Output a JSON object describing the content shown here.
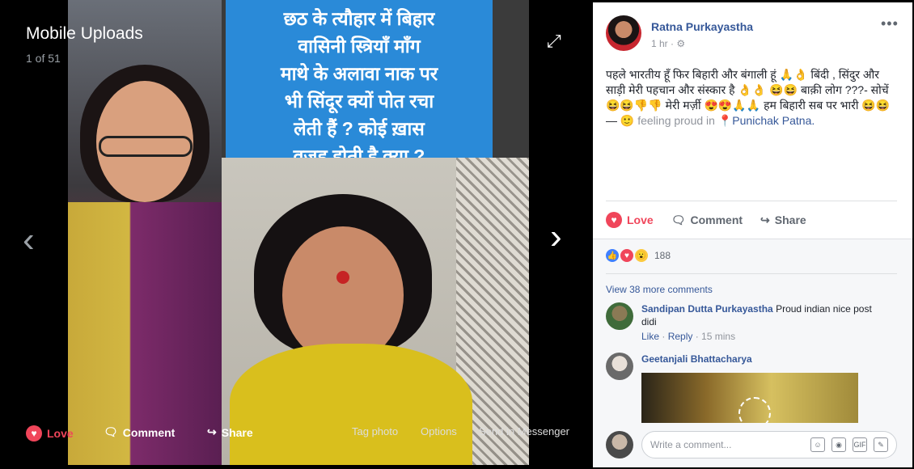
{
  "viewer": {
    "title": "Mobile Uploads",
    "count": "1 of 51",
    "sign_lines": [
      "छठ के त्यौहार में बिहार",
      "वासिनी स्त्रियाँ माँग",
      "माथे के अलावा नाक पर",
      "भी सिंदूर क्यों पोत रचा",
      "लेती हैं ? कोई ख़ास",
      "वजह होती है क्या ?"
    ],
    "actions": {
      "love": "Love",
      "comment": "Comment",
      "share": "Share",
      "tag": "Tag photo",
      "options": "Options",
      "messenger": "Send in Messenger"
    }
  },
  "post": {
    "author": "Ratna Purkayastha",
    "time": "1 hr",
    "text_main": "पहले भारतीय हूँ फिर बिहारी और बंगाली हूं 🙏👌 बिंदी , सिंदुर और साड़ी मेरी पहचान और संस्कार है 👌👌 😆😆 बाक़ी लोग ???- सोचें 😆😆👎👎 मेरी मर्ज़ी 😍😍🙏🙏 हम बिहारी सब पर भारी 😆😆 — ",
    "feeling": "feeling proud in",
    "location": "Punichak Patna",
    "location_suffix": ".",
    "actions": {
      "love": "Love",
      "comment": "Comment",
      "share": "Share"
    },
    "reaction_count": "188",
    "view_more": "View 38 more comments"
  },
  "comments": [
    {
      "name": "Sandipan Dutta Purkayastha",
      "text": "Proud indian nice post didi",
      "like": "Like",
      "reply": "Reply",
      "time": "15 mins"
    },
    {
      "name": "Geetanjali Bhattacharya"
    }
  ],
  "composer": {
    "placeholder": "Write a comment..."
  }
}
